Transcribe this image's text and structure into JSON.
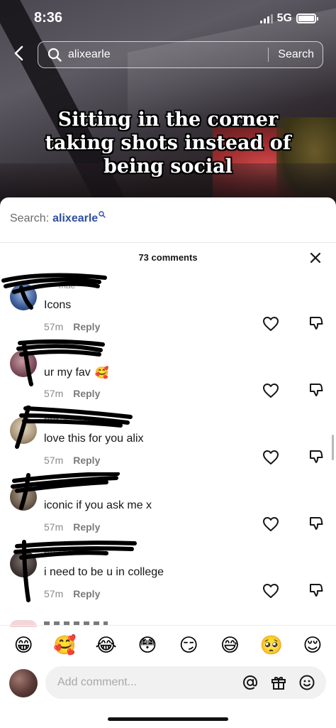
{
  "status_bar": {
    "time": "8:36",
    "network": "5G"
  },
  "search": {
    "query": "alixearle",
    "button": "Search"
  },
  "video": {
    "caption": "Sitting in the corner taking shots instead of being social"
  },
  "related_search": {
    "prefix": "Search:",
    "term": "alixearle"
  },
  "comments_header": {
    "count_label": "73 comments"
  },
  "comments": [
    {
      "username": "•••••mae",
      "text": "Icons",
      "emoji": "",
      "time": "57m",
      "reply": "Reply",
      "avatar_color": "#6b8ab8"
    },
    {
      "username": "•••••",
      "text": "ur my fav",
      "emoji": "🥰",
      "time": "57m",
      "reply": "Reply",
      "avatar_color": "#8a5a68"
    },
    {
      "username": "•••••zemder",
      "text": "love this for you alix",
      "emoji": "",
      "time": "57m",
      "reply": "Reply",
      "avatar_color": "#b7a98c"
    },
    {
      "username": "•••••",
      "text": "iconic if you ask me x",
      "emoji": "",
      "time": "57m",
      "reply": "Reply",
      "avatar_color": "#7a6a5a"
    },
    {
      "username": "••••iana",
      "text": "i need to be u in college",
      "emoji": "",
      "time": "57m",
      "reply": "Reply",
      "avatar_color": "#4a4240"
    }
  ],
  "emoji_bar": [
    "😁",
    "🥰",
    "😂",
    "😳",
    "😏",
    "😅",
    "🥺",
    "😌"
  ],
  "comment_input": {
    "placeholder": "Add comment..."
  },
  "icons": {
    "back": "chevron-left-icon",
    "search": "search-icon",
    "close": "close-icon",
    "like": "heart-icon",
    "dislike": "thumbs-down-icon",
    "mention": "at-icon",
    "gift": "gift-icon",
    "emoji": "emoji-icon"
  },
  "colors": {
    "accent": "#2f4fa0",
    "muted": "#8a8a8a"
  }
}
